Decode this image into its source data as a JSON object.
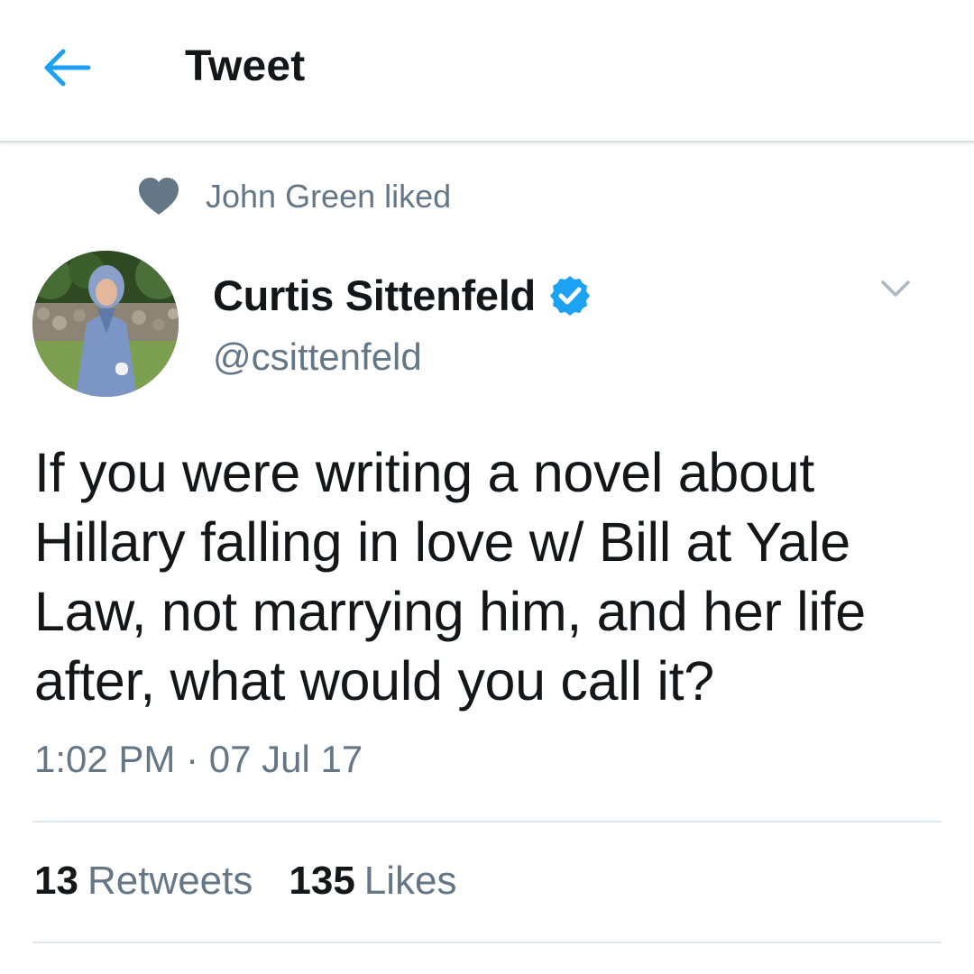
{
  "header": {
    "title": "Tweet",
    "back_icon": "arrow-left-icon",
    "accent_color": "#1da1f2"
  },
  "social_context": {
    "icon": "heart-icon",
    "text": "John Green liked"
  },
  "author": {
    "name": "Curtis Sittenfeld",
    "handle": "@csittenfeld",
    "verified": true,
    "verified_icon": "verified-badge-icon"
  },
  "tweet": {
    "text": "If you were writing a novel about Hillary falling in love w/ Bill at Yale Law, not marrying him, and her life after, what would you call it?",
    "timestamp": "1:02 PM · 07 Jul 17"
  },
  "stats": {
    "retweets_count": "13",
    "retweets_label": "Retweets",
    "likes_count": "135",
    "likes_label": "Likes"
  }
}
